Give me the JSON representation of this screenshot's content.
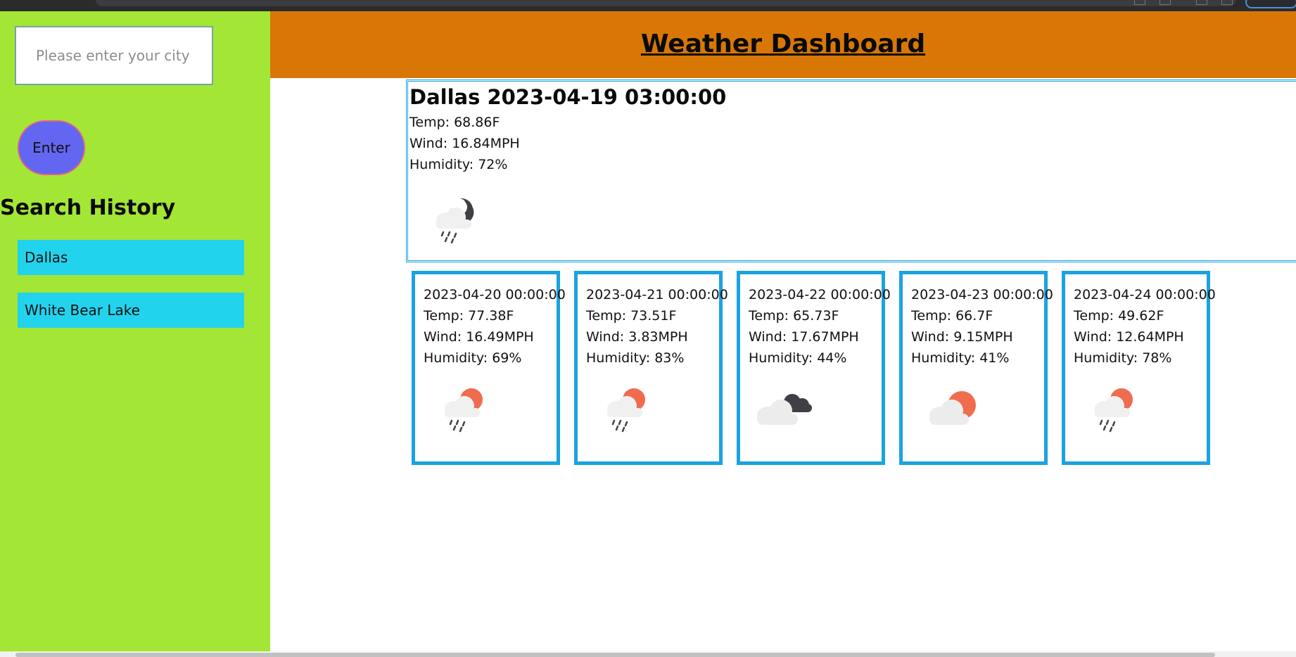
{
  "sidebar": {
    "search_placeholder": "Please enter your city",
    "enter_label": "Enter",
    "history_title": "Search History",
    "history": [
      "Dallas",
      "White Bear Lake"
    ]
  },
  "header": {
    "title": "Weather Dashboard"
  },
  "current": {
    "heading": "Dallas 2023-04-19 03:00:00",
    "temp": "Temp: 68.86F",
    "wind": "Wind: 16.84MPH",
    "humidity": "Humidity: 72%",
    "icon": "night-rain-icon"
  },
  "forecast": [
    {
      "date": "2023-04-20 00:00:00",
      "temp": "Temp: 77.38F",
      "wind": "Wind: 16.49MPH",
      "humidity": "Humidity: 69%",
      "icon": "sun-cloud-rain-icon"
    },
    {
      "date": "2023-04-21 00:00:00",
      "temp": "Temp: 73.51F",
      "wind": "Wind: 3.83MPH",
      "humidity": "Humidity: 83%",
      "icon": "sun-cloud-rain-icon"
    },
    {
      "date": "2023-04-22 00:00:00",
      "temp": "Temp: 65.73F",
      "wind": "Wind: 17.67MPH",
      "humidity": "Humidity: 44%",
      "icon": "dark-clouds-icon"
    },
    {
      "date": "2023-04-23 00:00:00",
      "temp": "Temp: 66.7F",
      "wind": "Wind: 9.15MPH",
      "humidity": "Humidity: 41%",
      "icon": "sun-cloud-icon"
    },
    {
      "date": "2023-04-24 00:00:00",
      "temp": "Temp: 49.62F",
      "wind": "Wind: 12.64MPH",
      "humidity": "Humidity: 78%",
      "icon": "sun-cloud-rain-icon"
    }
  ],
  "colors": {
    "sidebar": "#a3e635",
    "header": "#d97706",
    "enter_button": "#6366f1",
    "history_item": "#22d3ee",
    "card_border": "#1aa3e0"
  }
}
